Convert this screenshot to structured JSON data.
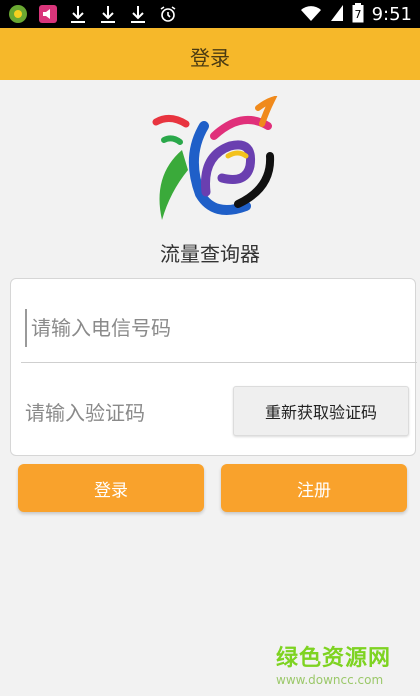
{
  "status_bar": {
    "time": "9:51",
    "battery_level": "7",
    "icons": [
      "app-icon-green",
      "speaker-notification-icon",
      "download-icon",
      "download-icon",
      "download-icon",
      "alarm-icon",
      "wifi-icon",
      "signal-icon",
      "battery-icon"
    ]
  },
  "header": {
    "title": "登录"
  },
  "logo": {
    "app_name": "流量查询器"
  },
  "form": {
    "phone_placeholder": "请输入电信号码",
    "code_placeholder": "请输入验证码",
    "resend_label": "重新获取验证码"
  },
  "actions": {
    "login_label": "登录",
    "register_label": "注册"
  },
  "watermark": {
    "title": "绿色资源网",
    "url": "www.downcc.com"
  },
  "colors": {
    "header_bg": "#f6b82a",
    "button_bg": "#f9a22c",
    "page_bg": "#f2f2f2"
  }
}
